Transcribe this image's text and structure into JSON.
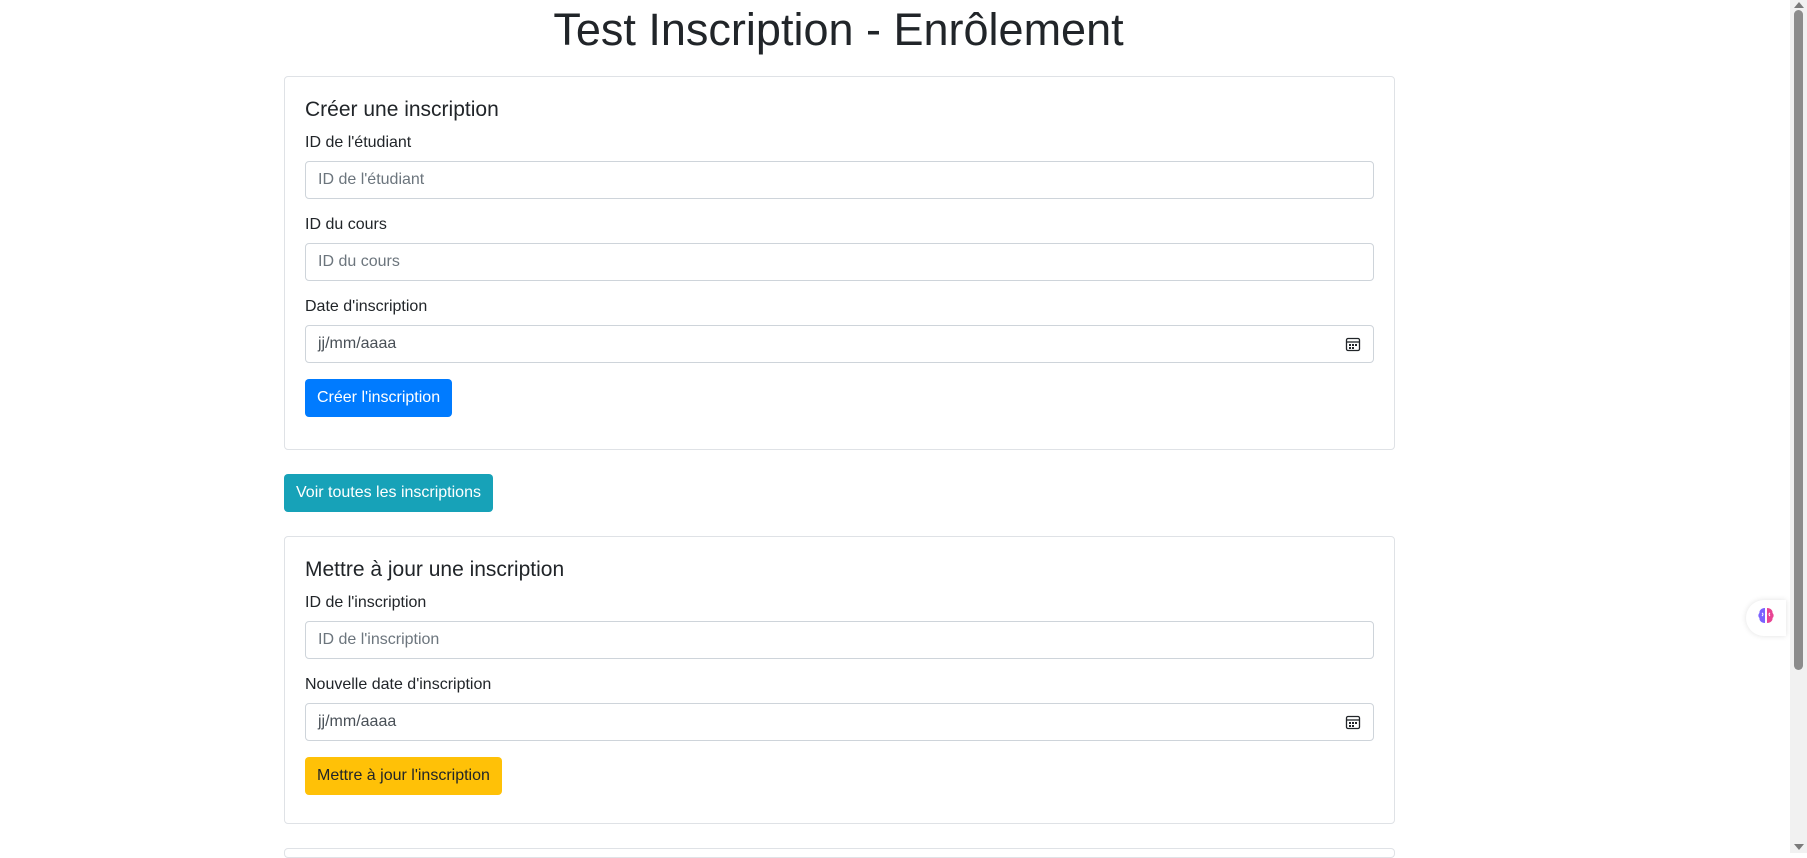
{
  "page": {
    "title": "Test Inscription - Enrôlement"
  },
  "create": {
    "title": "Créer une inscription",
    "student_label": "ID de l'étudiant",
    "student_placeholder": "ID de l'étudiant",
    "course_label": "ID du cours",
    "course_placeholder": "ID du cours",
    "date_label": "Date d'inscription",
    "date_placeholder": "jj/mm/aaaa",
    "button": "Créer l'inscription"
  },
  "view_all": {
    "button": "Voir toutes les inscriptions"
  },
  "update": {
    "title": "Mettre à jour une inscription",
    "enrollment_label": "ID de l'inscription",
    "enrollment_placeholder": "ID de l'inscription",
    "date_label": "Nouvelle date d'inscription",
    "date_placeholder": "jj/mm/aaaa",
    "button": "Mettre à jour l'inscription"
  },
  "colors": {
    "primary": "#007bff",
    "info": "#17a2b8",
    "warning": "#ffc107"
  },
  "icons": {
    "date": "calendar-icon",
    "assistant": "brain-icon"
  }
}
